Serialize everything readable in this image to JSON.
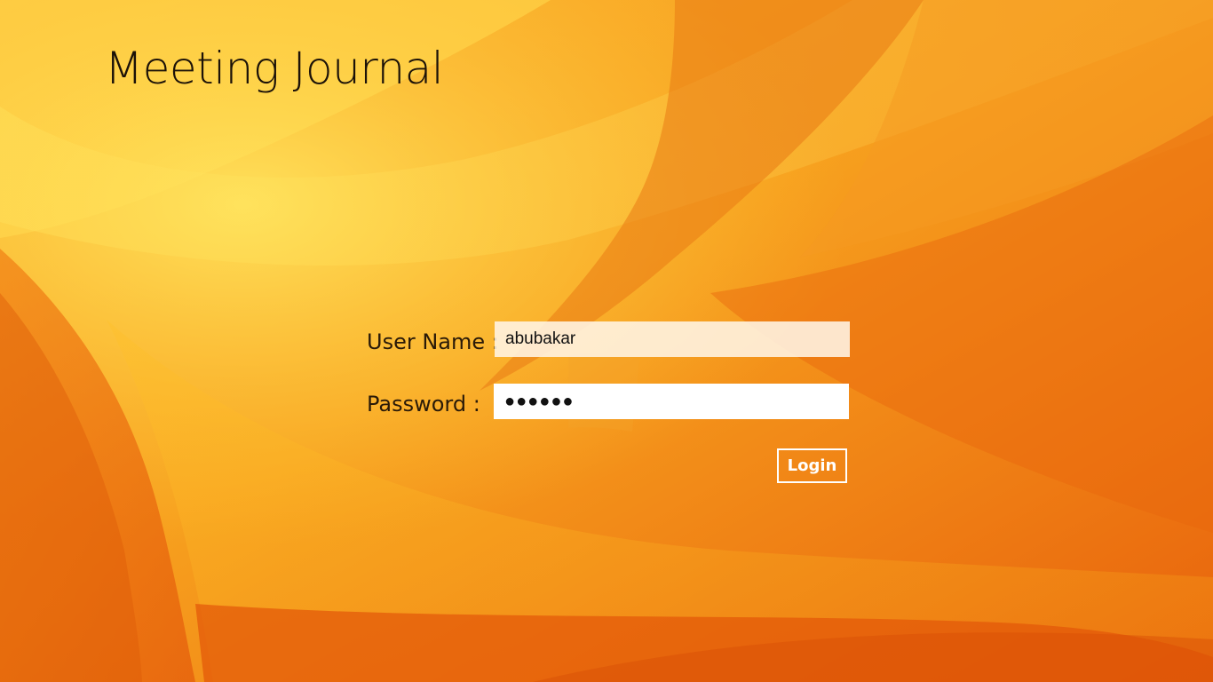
{
  "app": {
    "title": "Meeting Journal"
  },
  "login_form": {
    "username_label": "User Name :",
    "username_value": "abubakar",
    "password_label": "Password :",
    "password_value": "●●●●●●",
    "login_label": "Login"
  },
  "colors": {
    "background_primary": "#f28a12",
    "background_highlight": "#ffe15a",
    "background_deep": "#e05a08",
    "button_border": "#ffffff",
    "button_text": "#ffffff",
    "title_text": "#1c1208"
  }
}
